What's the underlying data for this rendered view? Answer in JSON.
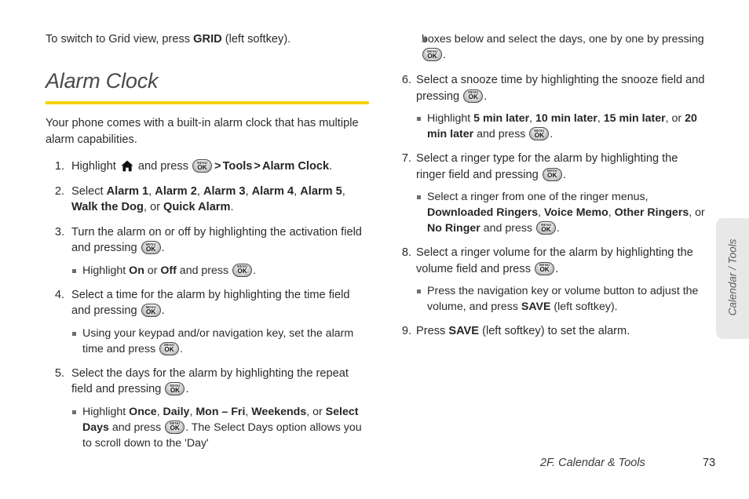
{
  "document": {
    "intro_line_pre": "To switch to Grid view, press ",
    "intro_line_bold": "GRID",
    "intro_line_post": " (left softkey).",
    "section_title": "Alarm Clock",
    "lead_paragraph": "Your phone comes with a built-in alarm clock that has multiple alarm capabilities."
  },
  "icons": {
    "key_menu_top": "MENU",
    "key_menu_bottom": "OK",
    "home_icon_name": "home-icon",
    "key_icon_name": "menu-ok-key-icon"
  },
  "steps": {
    "s1": {
      "num": "1.",
      "a": "Highlight ",
      "b": " and press ",
      "c": "Tools",
      "d": "Alarm Clock",
      "e": "."
    },
    "s2": {
      "num": "2.",
      "a": "Select ",
      "o1": "Alarm 1",
      "o2": "Alarm 2",
      "o3": "Alarm 3",
      "o4": "Alarm 4",
      "o5": "Alarm 5",
      "o6": "Walk the Dog",
      "mid": ", or ",
      "o7": "Quick Alarm",
      "end": "."
    },
    "s3": {
      "num": "3.",
      "a": "Turn the alarm on or off by highlighting the activation field and pressing ",
      "end": ".",
      "sub1_a": "Highlight ",
      "sub1_on": "On",
      "sub1_mid": " or ",
      "sub1_off": "Off",
      "sub1_b": " and press ",
      "sub1_end": "."
    },
    "s4": {
      "num": "4.",
      "a": "Select a time for the alarm by highlighting the time field and pressing ",
      "end": ".",
      "sub1_a": "Using your keypad and/or navigation key, set the alarm time and press ",
      "sub1_end": "."
    },
    "s5": {
      "num": "5.",
      "a": "Select the days for the alarm by highlighting the repeat field and pressing ",
      "end": ".",
      "sub1_a": "Highlight ",
      "o1": "Once",
      "o2": "Daily",
      "o3": "Mon – Fri",
      "o4": "Weekends",
      "sub1_mid": ", or ",
      "o5": "Select Days",
      "sub1_b": " and press ",
      "sub1_c": ". The Select Days option allows you to scroll down to the 'Day'"
    },
    "s5_cont": {
      "a": "boxes below and select the days, one by one by pressing ",
      "end": "."
    },
    "s6": {
      "num": "6.",
      "a": "Select a snooze time by highlighting the snooze field and pressing ",
      "end": ".",
      "sub1_a": "Highlight ",
      "o1": "5 min later",
      "o2": "10 min later",
      "o3": "15 min later",
      "sub1_mid": ", or ",
      "o4": "20 min later",
      "sub1_b": " and press ",
      "sub1_end": "."
    },
    "s7": {
      "num": "7.",
      "a": "Select a ringer type for the alarm by highlighting the ringer field and pressing ",
      "end": ".",
      "sub1_a": "Select a ringer from one of the ringer menus, ",
      "o1": "Downloaded Ringers",
      "o2": "Voice Memo",
      "o3": "Other Ringers",
      "sub1_mid": ", or ",
      "o4": "No Ringer",
      "sub1_b": " and press ",
      "sub1_end": "."
    },
    "s8": {
      "num": "8.",
      "a": "Select a ringer volume for the alarm by highlighting the volume field and press ",
      "end": ".",
      "sub1_a": "Press the navigation key or volume button to adjust the volume, and press ",
      "sub1_save": "SAVE",
      "sub1_end": " (left softkey)."
    },
    "s9": {
      "num": "9.",
      "a": "Press ",
      "save": "SAVE",
      "end": " (left softkey) to set the alarm."
    }
  },
  "side_tab": {
    "label": "Calendar / Tools"
  },
  "footer": {
    "title": "2F. Calendar & Tools",
    "page_number": "73"
  },
  "colors": {
    "accent_rule": "#f6d200",
    "body_text": "#2b2b2b",
    "heading": "#4a4a4a",
    "side_tab_bg": "#e8e8e8"
  }
}
